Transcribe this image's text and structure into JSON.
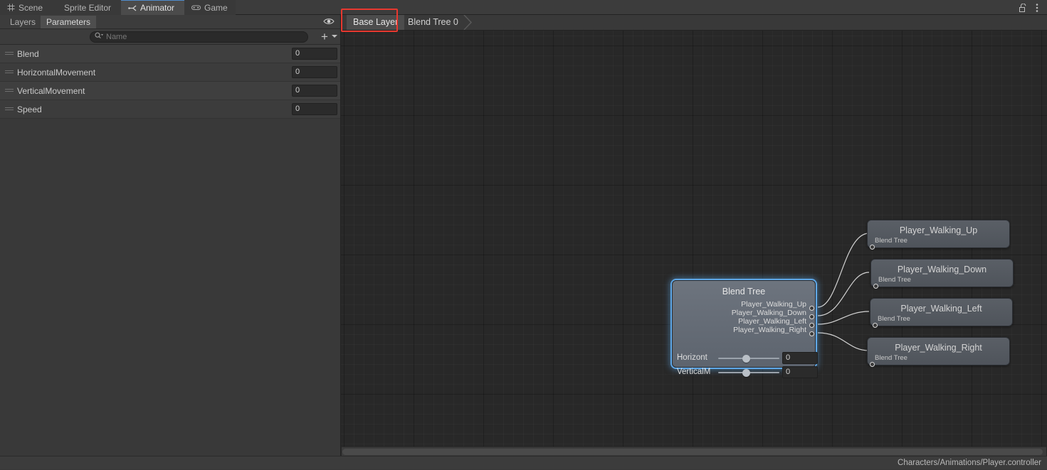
{
  "window": {
    "tabs": [
      {
        "label": "Scene",
        "icon": "grid-icon",
        "active": false
      },
      {
        "label": "Sprite Editor",
        "icon": "none",
        "active": false
      },
      {
        "label": "Animator",
        "icon": "bone-icon",
        "active": true
      },
      {
        "label": "Game",
        "icon": "gamepad-icon",
        "active": false
      }
    ],
    "lock_icon": "lock-open-icon",
    "menu_icon": "kebab-menu-icon"
  },
  "left_panel": {
    "tabs": [
      {
        "label": "Layers",
        "active": false
      },
      {
        "label": "Parameters",
        "active": true
      }
    ],
    "visibility_icon": "eye-icon",
    "search": {
      "placeholder": "Name",
      "value": "",
      "icon": "search-icon"
    },
    "add_button": {
      "label": "+",
      "caret": "chevron-down-icon"
    },
    "parameters": [
      {
        "name": "Blend",
        "value": "0"
      },
      {
        "name": "HorizontalMovement",
        "value": "0"
      },
      {
        "name": "VerticalMovement",
        "value": "0"
      },
      {
        "name": "Speed",
        "value": "0"
      }
    ]
  },
  "graph": {
    "breadcrumb": [
      {
        "label": "Base Layer",
        "selected": true,
        "highlighted": true
      },
      {
        "label": "Blend Tree 0",
        "selected": false,
        "highlighted": false
      }
    ],
    "blend_tree_node": {
      "title": "Blend Tree",
      "motions": [
        "Player_Walking_Up",
        "Player_Walking_Down",
        "Player_Walking_Left",
        "Player_Walking_Right"
      ],
      "sliders": [
        {
          "label": "Horizont",
          "value": "0"
        },
        {
          "label": "VerticalM",
          "value": "0"
        }
      ]
    },
    "state_nodes": [
      {
        "title": "Player_Walking_Up",
        "subtitle": "Blend Tree"
      },
      {
        "title": "Player_Walking_Down",
        "subtitle": "Blend Tree"
      },
      {
        "title": "Player_Walking_Left",
        "subtitle": "Blend Tree"
      },
      {
        "title": "Player_Walking_Right",
        "subtitle": "Blend Tree"
      }
    ]
  },
  "status_bar": {
    "path": "Characters/Animations/Player.controller"
  },
  "colors": {
    "accent_blue": "#5fa8e8",
    "highlight_red": "#e8382f",
    "panel_bg": "#393939",
    "graph_bg": "#282828"
  }
}
